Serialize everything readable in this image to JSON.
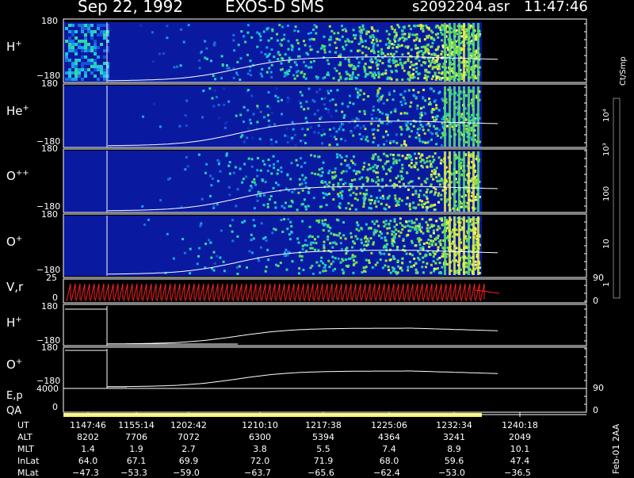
{
  "header": {
    "date": "Sep 22, 1992",
    "instrument": "EXOS-D SMS",
    "file": "s2092204.asr",
    "time": "11:47:46"
  },
  "chart_data": {
    "type": "heatmap",
    "panels": [
      {
        "kind": "spectrogram",
        "label_base": "H",
        "label_sup": "+",
        "ymax": "180",
        "ymin": "−180"
      },
      {
        "kind": "spectrogram",
        "label_base": "He",
        "label_sup": "+",
        "ymax": "180",
        "ymin": "−180"
      },
      {
        "kind": "spectrogram",
        "label_base": "O",
        "label_sup": "++",
        "ymax": "180",
        "ymin": "−180"
      },
      {
        "kind": "spectrogram",
        "label_base": "O",
        "label_sup": "+",
        "ymax": "180",
        "ymin": "−180"
      },
      {
        "kind": "vr",
        "label_base": "V,r",
        "label_sup": "",
        "ymax": "25",
        "ymin": "0",
        "right_top": "90",
        "right_bottom": "0"
      },
      {
        "kind": "line",
        "label_base": "H",
        "label_sup": "+",
        "ymax": "180",
        "ymin": "−180"
      },
      {
        "kind": "line",
        "label_base": "O",
        "label_sup": "+",
        "ymax": "180",
        "ymin": "−180",
        "right_top": "90",
        "right_bottom": "0"
      },
      {
        "kind": "ep",
        "label_base": "E,p",
        "label2": "QA",
        "ymax": "4000",
        "ymin": "0",
        "right_top": "90",
        "right_bottom": "0"
      }
    ],
    "colorbar": {
      "unit": "Ct/Smp",
      "labels": [
        "10⁴",
        "10³",
        "100",
        "10",
        "1"
      ]
    },
    "ephemeris": {
      "row_labels": [
        "UT",
        "ALT",
        "MLT",
        "InLat",
        "MLat"
      ],
      "columns": [
        {
          "UT": "1147:46",
          "ALT": "8202",
          "MLT": "1.4",
          "InLat": "64.0",
          "MLat": "−47.3"
        },
        {
          "UT": "1155:14",
          "ALT": "7706",
          "MLT": "1.9",
          "InLat": "67.1",
          "MLat": "−53.3"
        },
        {
          "UT": "1202:42",
          "ALT": "7072",
          "MLT": "2.7",
          "InLat": "69.9",
          "MLat": "−59.0"
        },
        {
          "UT": "1210:10",
          "ALT": "6300",
          "MLT": "3.8",
          "InLat": "72.0",
          "MLat": "−63.7"
        },
        {
          "UT": "1217:38",
          "ALT": "5394",
          "MLT": "5.5",
          "InLat": "71.9",
          "MLat": "−65.6"
        },
        {
          "UT": "1225:06",
          "ALT": "4364",
          "MLT": "7.4",
          "InLat": "68.0",
          "MLat": "−62.4"
        },
        {
          "UT": "1232:34",
          "ALT": "3241",
          "MLT": "8.9",
          "InLat": "59.6",
          "MLat": "−53.0"
        },
        {
          "UT": "1240:18",
          "ALT": "2049",
          "MLT": "10.1",
          "InLat": "47.4",
          "MLat": "−36.5"
        }
      ]
    },
    "qa_bar": {
      "color": "#f2f060",
      "coverage_fraction": 0.8
    }
  },
  "footer_code": "Feb-01 2AA",
  "colors": {
    "frame": "#ffffff",
    "background": "#000000",
    "spec_bg": "#0a1aa0",
    "vr": "#ff2020",
    "qa": "#f2f060"
  }
}
